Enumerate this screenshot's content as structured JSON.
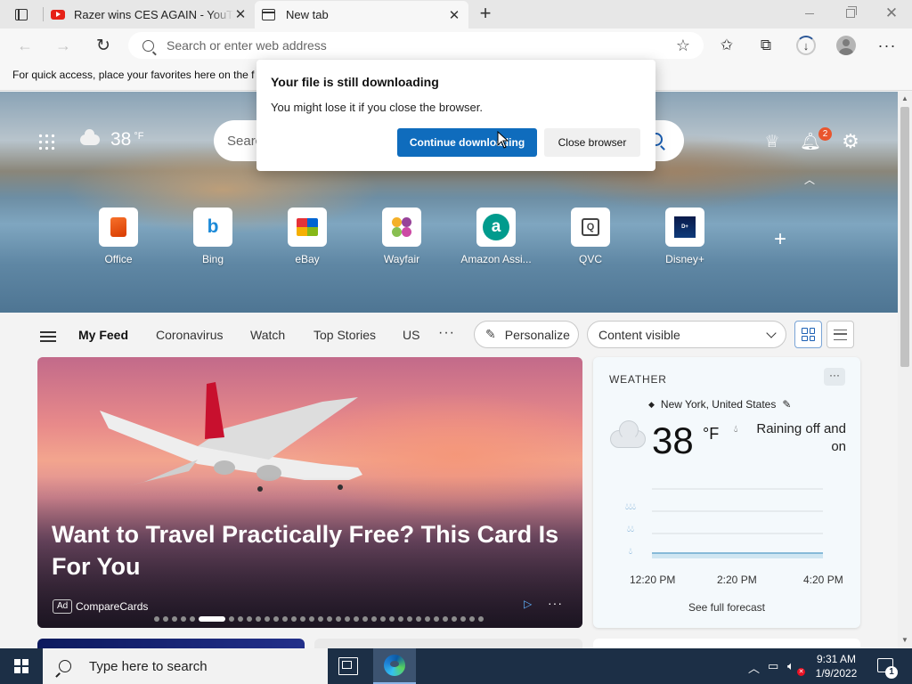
{
  "tabs": [
    {
      "title": "Razer wins CES AGAIN - YouTube",
      "active": false,
      "icon": "youtube-icon"
    },
    {
      "title": "New tab",
      "active": true,
      "icon": "newtab-icon"
    }
  ],
  "toolbar": {
    "address_placeholder": "Search or enter web address"
  },
  "favorites_bar": {
    "hint": "For quick access, place your favorites here on the favorites bar."
  },
  "newtab": {
    "weather_temp": "38",
    "weather_unit": "°F",
    "search_placeholder": "Search the web",
    "notification_count": "2",
    "quick_links": [
      {
        "label": "Office",
        "icon": "office-icon"
      },
      {
        "label": "Bing",
        "icon": "bing-icon"
      },
      {
        "label": "eBay",
        "icon": "ebay-icon"
      },
      {
        "label": "Wayfair",
        "icon": "wayfair-icon"
      },
      {
        "label": "Amazon Assi...",
        "icon": "amazon-assistant-icon"
      },
      {
        "label": "QVC",
        "icon": "qvc-icon"
      },
      {
        "label": "Disney+",
        "icon": "disney-plus-icon"
      }
    ],
    "feed_tabs": [
      "My Feed",
      "Coronavirus",
      "Watch",
      "Top Stories",
      "US"
    ],
    "personalize_label": "Personalize",
    "content_visibility": "Content visible"
  },
  "hero_article": {
    "title": "Want to Travel Practically Free? This Card Is For You",
    "ad_label": "Ad",
    "source": "CompareCards",
    "slide_count": 35,
    "active_slide": 5
  },
  "weather_card": {
    "heading": "WEATHER",
    "location": "New York, United States",
    "temperature": "38",
    "unit": "°F",
    "condition": "Raining off and on",
    "time_labels": [
      "12:20 PM",
      "2:20 PM",
      "4:20 PM"
    ],
    "forecast_link": "See full forecast"
  },
  "download_popup": {
    "title": "Your file is still downloading",
    "message": "You might lose it if you close the browser.",
    "continue_label": "Continue downloading",
    "close_label": "Close browser"
  },
  "taskbar": {
    "search_placeholder": "Type here to search",
    "time": "9:31 AM",
    "date": "1/9/2022",
    "notification_count": "1"
  },
  "colors": {
    "accent": "#0f6cbd",
    "taskbar": "#1c2f46",
    "badge": "#e9552d"
  }
}
